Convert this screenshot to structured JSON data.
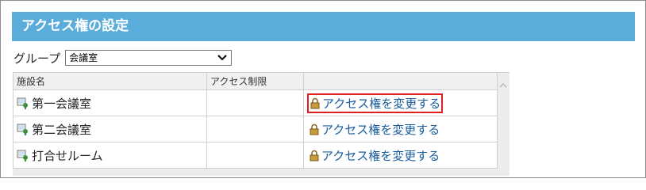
{
  "header": {
    "title": "アクセス権の設定"
  },
  "group": {
    "label": "グループ",
    "selected": "会議室"
  },
  "table": {
    "columns": [
      "施設名",
      "アクセス制限",
      ""
    ],
    "rows": [
      {
        "name": "第一会議室",
        "restriction": "",
        "action": "アクセス権を変更する",
        "highlighted": true
      },
      {
        "name": "第二会議室",
        "restriction": "",
        "action": "アクセス権を変更する",
        "highlighted": false
      },
      {
        "name": "打合せルーム",
        "restriction": "",
        "action": "アクセス権を変更する",
        "highlighted": false
      }
    ]
  },
  "icons": {
    "facility": "facility-icon",
    "lock": "lock-icon",
    "dropdown": "chevron-down-icon",
    "scroll": "chevron-up-icon"
  },
  "colors": {
    "header_bg": "#5aaddb",
    "link": "#1a5c9e",
    "highlight": "#e02020"
  }
}
